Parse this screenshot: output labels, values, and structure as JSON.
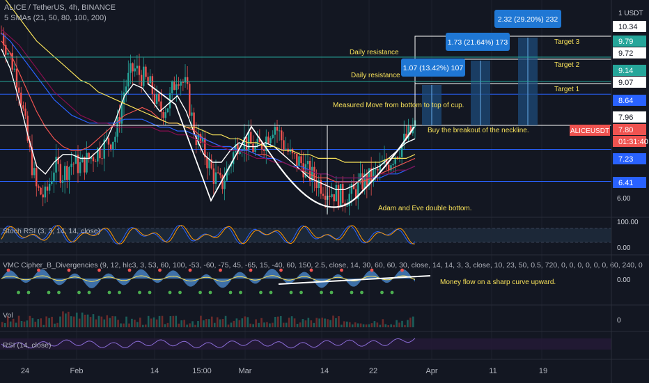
{
  "header": {
    "symbol_line": "ALICE / TetherUS, 4h, BINANCE",
    "sma_line": "5 SMAs (21, 50, 80, 100, 200)",
    "currency": "1 USDT"
  },
  "price_axis": {
    "tags": [
      {
        "value": "10.34",
        "bg": "#ffffff",
        "fg": "#131722"
      },
      {
        "value": "9.79",
        "bg": "#26a69a",
        "fg": "#ffffff"
      },
      {
        "value": "9.72",
        "bg": "#ffffff",
        "fg": "#131722"
      },
      {
        "value": "9.14",
        "bg": "#26a69a",
        "fg": "#ffffff"
      },
      {
        "value": "9.07",
        "bg": "#ffffff",
        "fg": "#131722"
      },
      {
        "value": "8.64",
        "bg": "#2962ff",
        "fg": "#ffffff"
      },
      {
        "value": "7.96",
        "bg": "#ffffff",
        "fg": "#131722"
      },
      {
        "value": "7.80",
        "bg": "#ef5350",
        "fg": "#ffffff"
      },
      {
        "value": "01:31:40",
        "bg": "#ef5350",
        "fg": "#ffffff"
      },
      {
        "value": "7.23",
        "bg": "#2962ff",
        "fg": "#ffffff"
      },
      {
        "value": "6.41",
        "bg": "#2962ff",
        "fg": "#ffffff"
      }
    ],
    "plain_ticks": [
      "6.00"
    ],
    "symbol_tag": "ALICEUSDT",
    "stoch_ticks": [
      "100.00",
      "0.00"
    ],
    "cipher_tick": "0.00",
    "vol_tick": "0"
  },
  "time_axis": [
    "24",
    "Feb",
    "14",
    "15:00",
    "Mar",
    "14",
    "22",
    "Apr",
    "11",
    "19"
  ],
  "annotations": {
    "daily_res_1": "Daily resistance",
    "daily_res_2": "Daily resistance",
    "measured_move": "Measured Move from bottom to top of cup.",
    "breakout": "Buy the breakout of the neckline.",
    "adam_eve": "Adam and Eve double bottom.",
    "money_flow": "Money flow on a sharp curve upward.",
    "target1": "Target 1",
    "target2": "Target 2",
    "target3": "Target 3"
  },
  "measure_labels": [
    "1.07 (13.42%) 107",
    "1.73 (21.64%) 173",
    "2.32 (29.20%) 232"
  ],
  "indicators": {
    "stoch": "Stoch RSI (3, 3, 14, 14, close)",
    "cipher": "VMC Cipher_B_Divergencies (9, 12, hlc3, 3, 53, 60, 100, -53, -60, -75, 45, -65, 15, -40, 60, 150, 2.5, close, 14, 30, 60, 60, 30, close, 14, 14, 3, 3, close, 10, 23, 50, 0.5, 720, 0, 0, 0, 0, 0, 0, 60, 240, 0",
    "vol": "Vol",
    "rsi": "RSI (14, close)"
  },
  "chart_data": {
    "type": "line",
    "title": "ALICE / TetherUS, 4h, BINANCE",
    "close": [
      10.2,
      9.6,
      8.9,
      7.4,
      6.2,
      6.0,
      6.8,
      6.6,
      6.9,
      6.8,
      7.0,
      7.2,
      7.4,
      7.6,
      8.8,
      9.3,
      9.1,
      8.8,
      8.2,
      8.4,
      9.2,
      8.8,
      7.6,
      7.2,
      6.6,
      6.3,
      6.9,
      7.5,
      7.4,
      7.2,
      7.5,
      7.9,
      7.4,
      7.0,
      6.9,
      6.6,
      6.4,
      6.2,
      6.1,
      6.0,
      6.1,
      6.4,
      6.5,
      6.7,
      6.9,
      7.2,
      7.5,
      7.8
    ],
    "series": [
      {
        "name": "SMA 21",
        "color": "#ffffff",
        "values": [
          9.8,
          9.3,
          8.5,
          7.6,
          6.8,
          6.6,
          6.9,
          7.1,
          7.1,
          7.0,
          7.0,
          7.2,
          7.5,
          8.0,
          8.6,
          8.9,
          8.8,
          8.5,
          8.2,
          8.4,
          8.6,
          8.2,
          7.6,
          7.1,
          6.9,
          6.9,
          7.2,
          7.4,
          7.3,
          7.3,
          7.4,
          7.3,
          7.1,
          6.9,
          6.7,
          6.5,
          6.4,
          6.3,
          6.2,
          6.2,
          6.3,
          6.5,
          6.7,
          6.8,
          7.0,
          7.2,
          7.4,
          7.5
        ]
      },
      {
        "name": "SMA 50",
        "color": "#ef5350",
        "values": [
          10.0,
          9.7,
          9.2,
          8.7,
          8.2,
          7.8,
          7.5,
          7.3,
          7.2,
          7.2,
          7.3,
          7.5,
          7.7,
          7.9,
          8.1,
          8.2,
          8.3,
          8.2,
          8.0,
          7.9,
          7.9,
          7.8,
          7.7,
          7.5,
          7.4,
          7.3,
          7.3,
          7.2,
          7.2,
          7.1,
          7.1,
          7.0,
          6.9,
          6.8,
          6.7,
          6.6,
          6.5,
          6.5,
          6.4,
          6.4,
          6.4,
          6.4,
          6.5,
          6.6,
          6.7,
          6.8,
          6.9,
          7.0
        ]
      },
      {
        "name": "SMA 80",
        "color": "#2962ff",
        "values": [
          10.2,
          10.0,
          9.7,
          9.4,
          9.1,
          8.8,
          8.5,
          8.3,
          8.1,
          8.0,
          7.9,
          7.9,
          7.9,
          7.9,
          8.0,
          8.0,
          8.0,
          7.9,
          7.8,
          7.8,
          7.7,
          7.7,
          7.6,
          7.5,
          7.4,
          7.3,
          7.3,
          7.2,
          7.2,
          7.1,
          7.0,
          7.0,
          6.9,
          6.8,
          6.8,
          6.7,
          6.6,
          6.6,
          6.5,
          6.5,
          6.5,
          6.5,
          6.5,
          6.5,
          6.6,
          6.6,
          6.7,
          6.8
        ]
      },
      {
        "name": "SMA 100",
        "color": "#880e4f",
        "values": [
          10.3,
          10.1,
          9.9,
          9.6,
          9.3,
          9.0,
          8.7,
          8.5,
          8.3,
          8.1,
          8.0,
          7.9,
          7.9,
          7.8,
          7.8,
          7.8,
          7.8,
          7.8,
          7.7,
          7.7,
          7.6,
          7.6,
          7.5,
          7.4,
          7.3,
          7.3,
          7.2,
          7.2,
          7.1,
          7.0,
          7.0,
          6.9,
          6.9,
          6.8,
          6.7,
          6.7,
          6.6,
          6.6,
          6.5,
          6.5,
          6.5,
          6.5,
          6.5,
          6.6,
          6.6,
          6.7,
          6.7,
          6.8
        ]
      },
      {
        "name": "SMA 200",
        "color": "#f7e15a",
        "values": [
          11.2,
          10.9,
          10.6,
          10.3,
          10.0,
          9.8,
          9.6,
          9.4,
          9.2,
          9.0,
          8.9,
          8.7,
          8.6,
          8.5,
          8.4,
          8.3,
          8.2,
          8.1,
          8.0,
          7.9,
          7.9,
          7.8,
          7.8,
          7.7,
          7.6,
          7.6,
          7.5,
          7.5,
          7.4,
          7.4,
          7.3,
          7.3,
          7.2,
          7.2,
          7.1,
          7.1,
          7.0,
          7.0,
          7.0,
          6.9,
          6.9,
          6.9,
          6.9,
          6.9,
          7.0,
          7.0,
          7.0,
          7.1
        ]
      }
    ],
    "levels": [
      6.41,
      7.23,
      7.96,
      8.64,
      9.07,
      9.72,
      10.34
    ],
    "targets": [
      9.07,
      9.72,
      10.34
    ],
    "ylim": [
      5.6,
      10.8
    ]
  },
  "colors": {
    "bg": "#131722",
    "up": "#26a69a",
    "down": "#ef5350",
    "level": "#2962ff",
    "grid": "#1e222d"
  }
}
